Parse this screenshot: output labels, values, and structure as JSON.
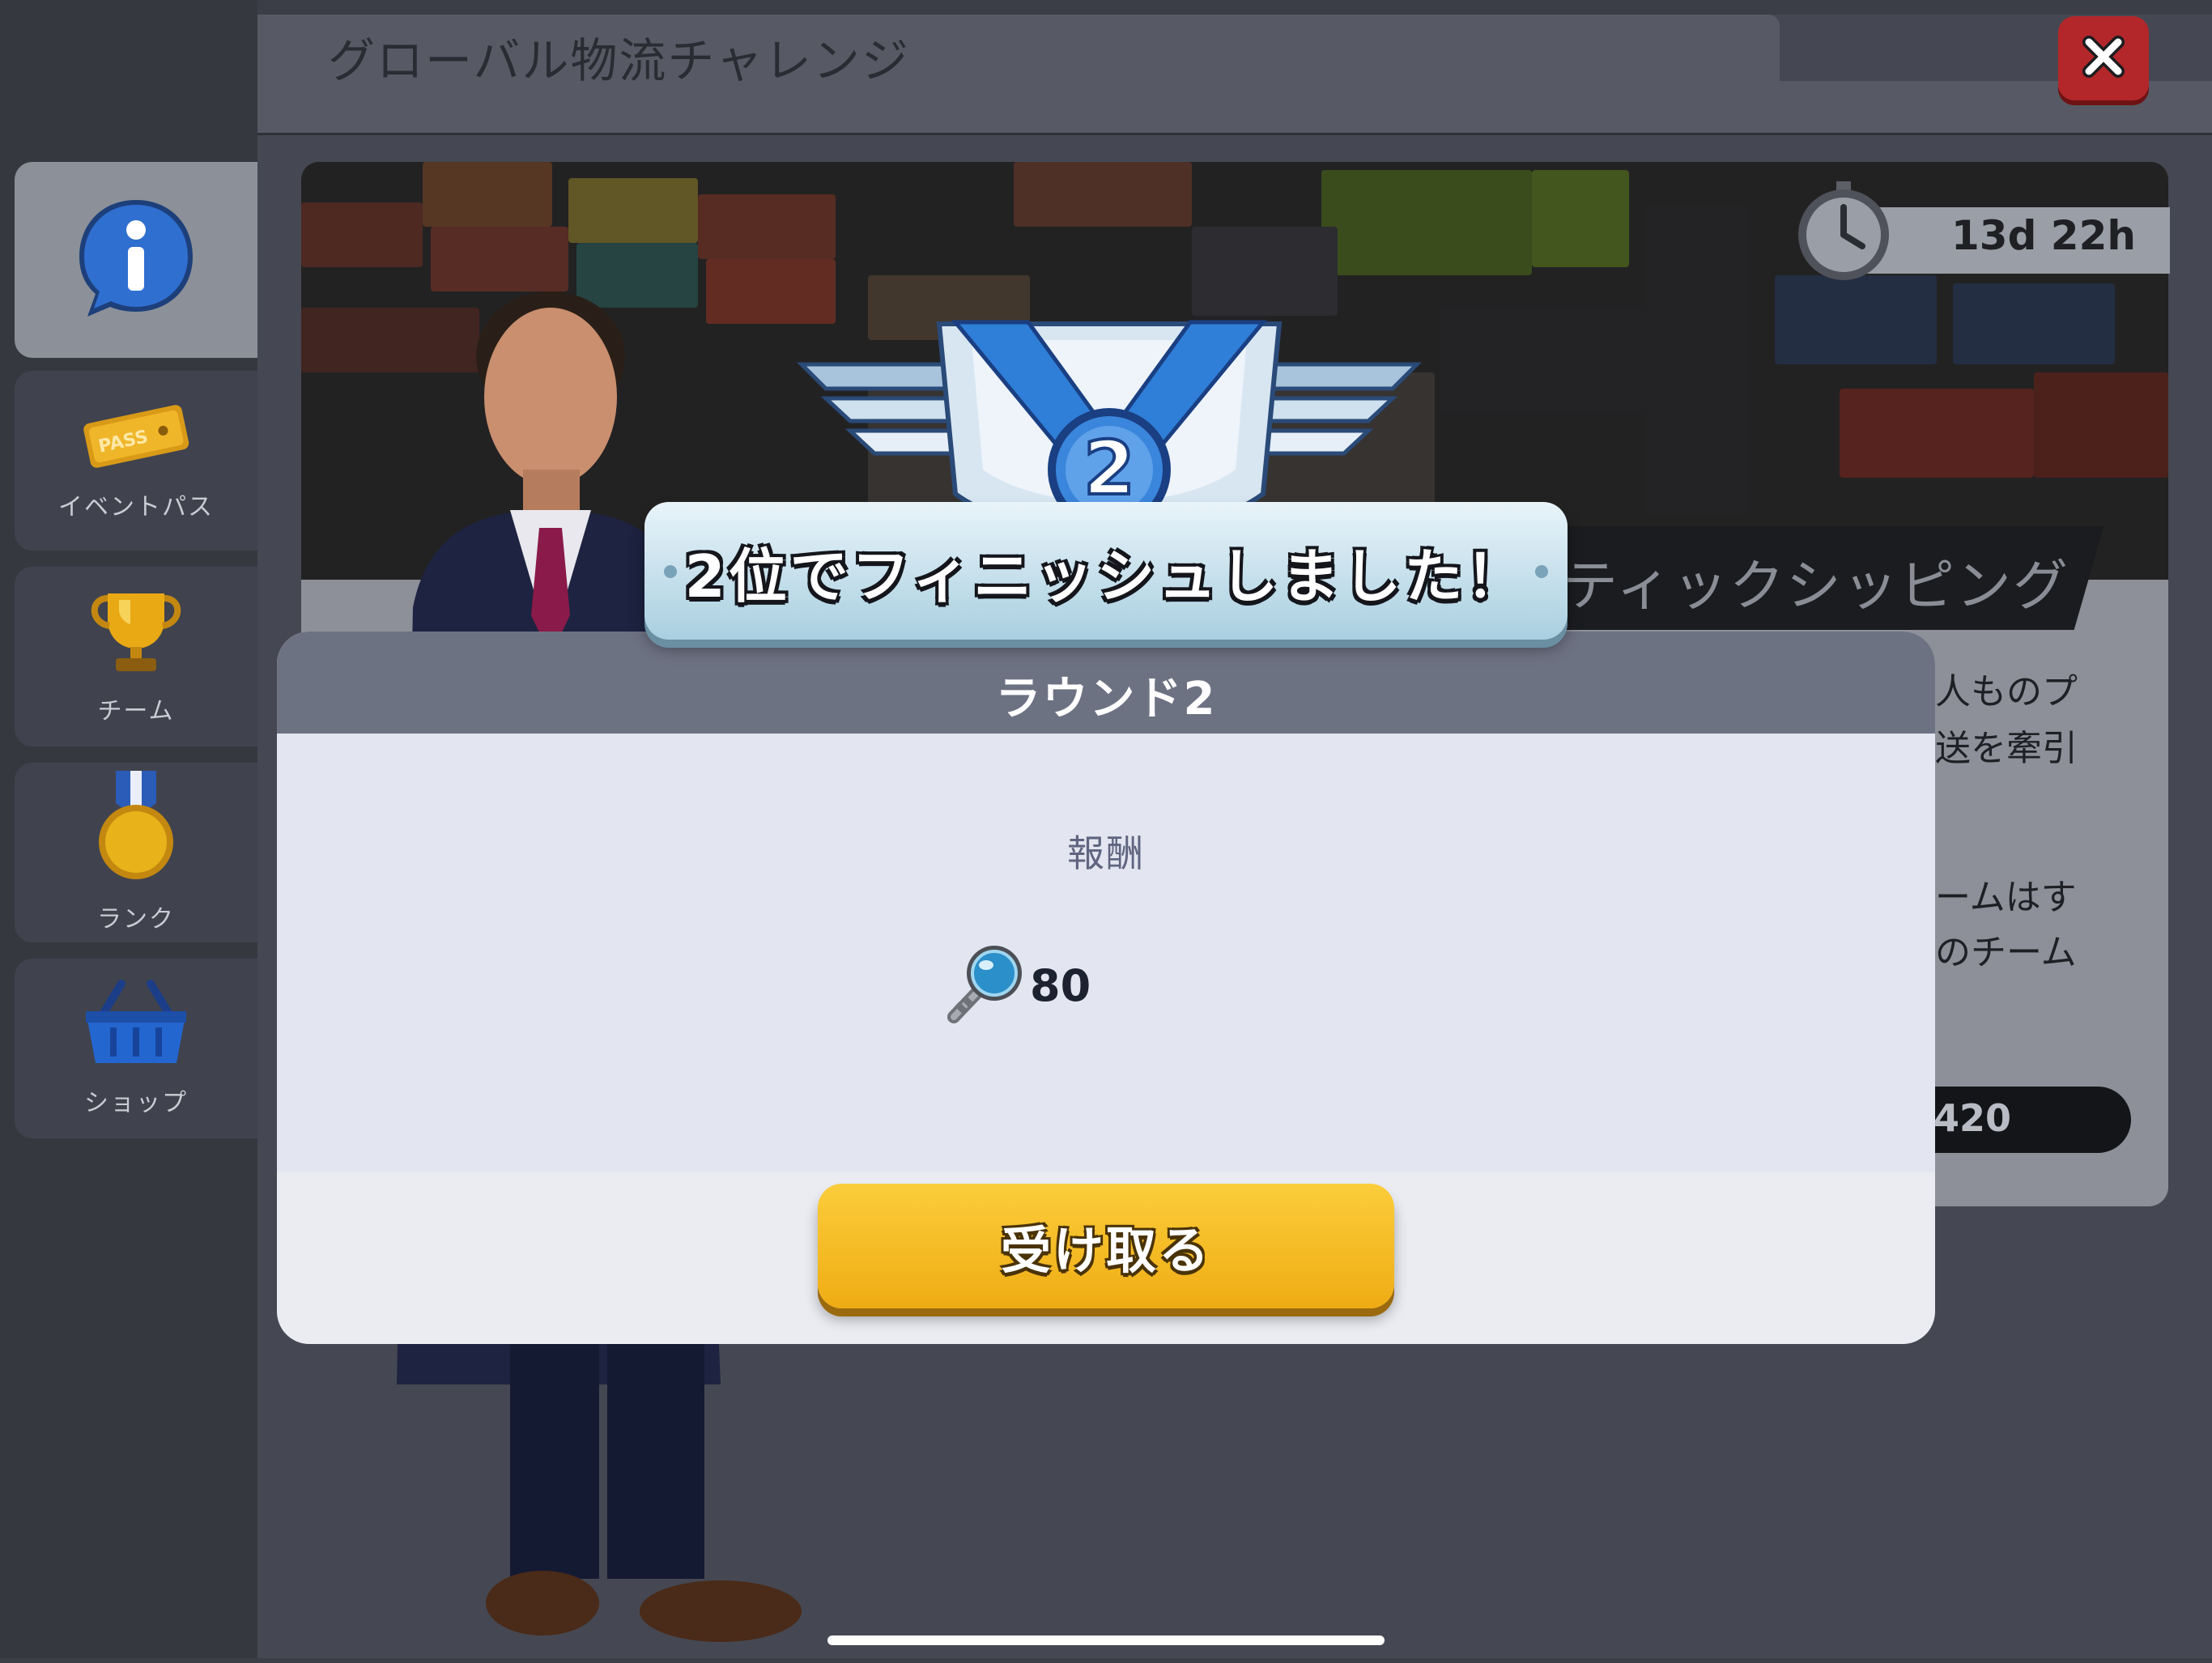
{
  "window": {
    "title": "グローバル物流チャレンジ",
    "close_icon": "close-icon"
  },
  "sidebar": {
    "items": [
      {
        "icon": "info-icon",
        "label": ""
      },
      {
        "icon": "pass-ticket-icon",
        "label": "イベントパス"
      },
      {
        "icon": "trophy-icon",
        "label": "チーム"
      },
      {
        "icon": "medal-icon",
        "label": "ランク"
      },
      {
        "icon": "basket-icon",
        "label": "ショップ"
      }
    ]
  },
  "banner": {
    "timer_icon": "stopwatch-icon",
    "timer": "13d 22h",
    "ribbon_text": "ティックシッピング"
  },
  "info": {
    "line1": "人ものプ",
    "line2": "送を牽引",
    "line3": "ームはす",
    "line4": "のチーム",
    "score": "420"
  },
  "popup": {
    "finish_text": "2位でフィニッシュしました！",
    "medal_rank": "2",
    "header": "ラウンド2",
    "reward_label": "報酬",
    "reward_icon": "magnifier-key-icon",
    "reward_value": "80",
    "claim_label": "受け取る"
  },
  "colors": {
    "claim_button": "#f5b820",
    "close_button": "#b3272b",
    "medal_blue": "#2f7fd8"
  }
}
